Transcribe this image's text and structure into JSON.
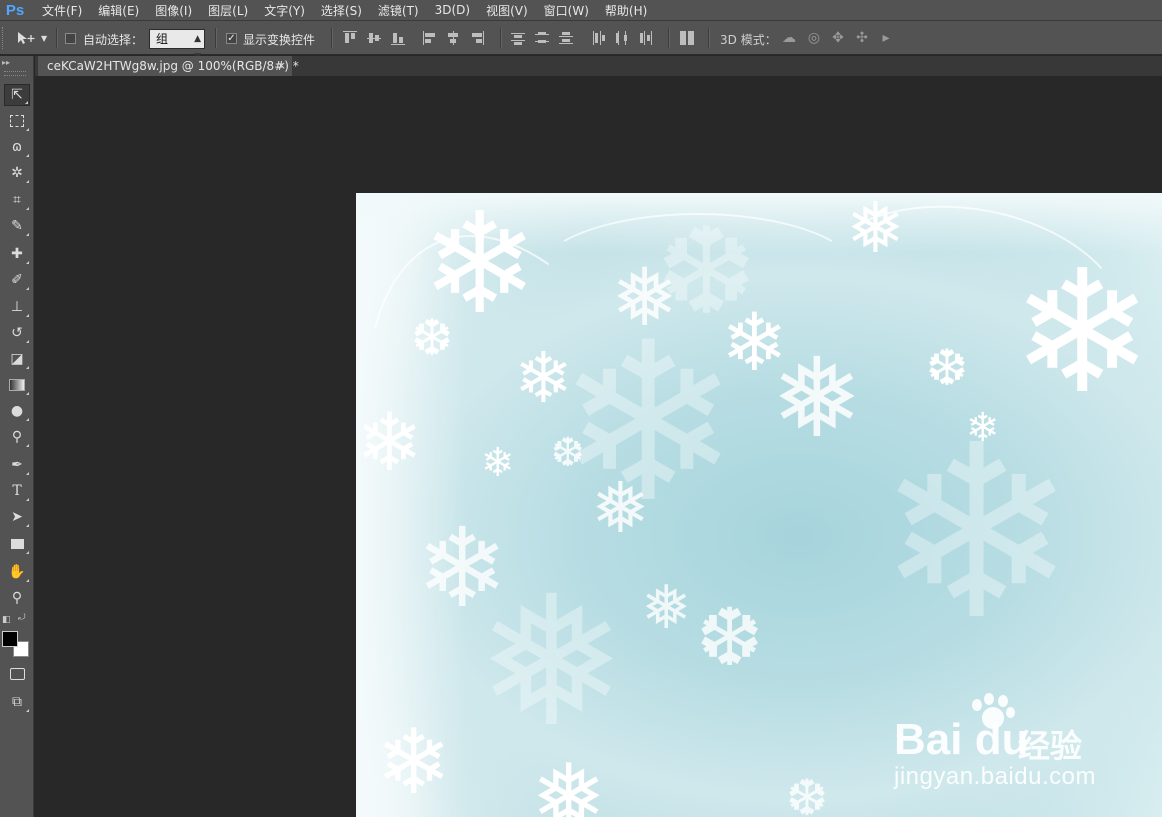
{
  "app": {
    "logo": "Ps"
  },
  "menu": [
    "文件(F)",
    "编辑(E)",
    "图像(I)",
    "图层(L)",
    "文字(Y)",
    "选择(S)",
    "滤镜(T)",
    "3D(D)",
    "视图(V)",
    "窗口(W)",
    "帮助(H)"
  ],
  "options": {
    "auto_select_label": "自动选择：",
    "auto_select_checked": false,
    "auto_select_target": "组",
    "show_transform_label": "显示变换控件",
    "show_transform_checked": true,
    "mode3d_label": "3D 模式：",
    "mode3d_icons": [
      "rotate-3d-icon",
      "roll-3d-icon",
      "drag-3d-icon",
      "slide-3d-icon",
      "scale-3d-icon"
    ]
  },
  "document": {
    "tab_title": "ceKCaW2HTWg8w.jpg @ 100%(RGB/8#) *",
    "close_glyph": "×"
  },
  "tools": [
    "move-tool-icon",
    "marquee-tool-icon",
    "lasso-tool-icon",
    "magic-wand-icon",
    "crop-tool-icon",
    "eyedropper-icon",
    "healing-brush-icon",
    "brush-tool-icon",
    "clone-stamp-icon",
    "history-brush-icon",
    "eraser-icon",
    "gradient-tool-icon",
    "blur-tool-icon",
    "dodge-tool-icon",
    "pen-tool-icon",
    "type-tool-icon",
    "path-selection-icon",
    "rectangle-tool-icon",
    "hand-tool-icon",
    "zoom-tool-icon"
  ],
  "colors": {
    "foreground": "#000000",
    "background": "#ffffff"
  },
  "watermark": {
    "logo_text": "Bai  du",
    "cn_text": "经验",
    "url": "jingyan.baidu.com"
  }
}
